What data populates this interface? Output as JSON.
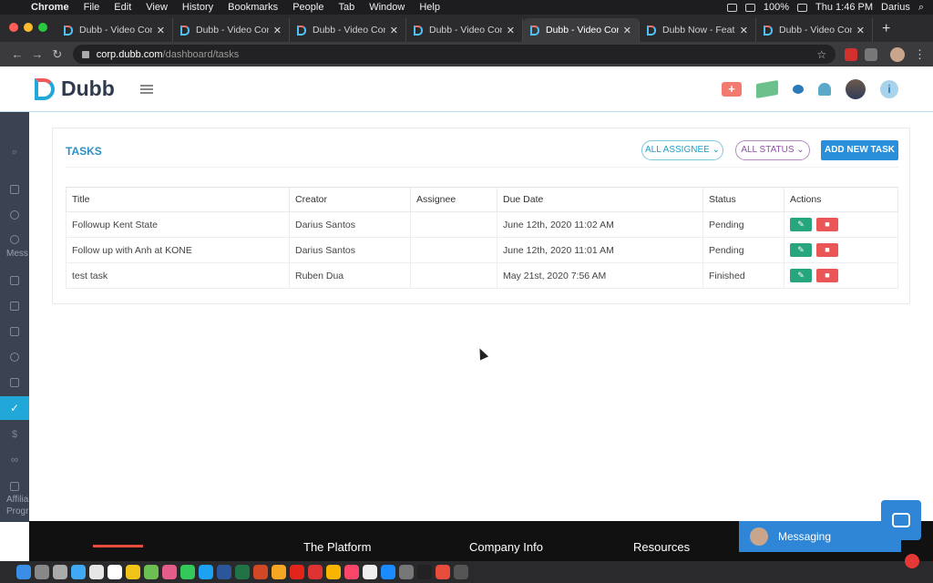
{
  "menubar": {
    "app_name": "Chrome",
    "menus": [
      "File",
      "Edit",
      "View",
      "History",
      "Bookmarks",
      "People",
      "Tab",
      "Window",
      "Help"
    ],
    "battery": "100%",
    "clock": "Thu 1:46 PM",
    "user": "Darius"
  },
  "tabs": [
    {
      "label": "Dubb - Video Comm",
      "active": false
    },
    {
      "label": "Dubb - Video Comm",
      "active": false
    },
    {
      "label": "Dubb - Video Comm",
      "active": false
    },
    {
      "label": "Dubb - Video Comm",
      "active": false
    },
    {
      "label": "Dubb - Video Comm",
      "active": true
    },
    {
      "label": "Dubb Now - Feature",
      "active": false
    },
    {
      "label": "Dubb - Video Comm",
      "active": false
    }
  ],
  "address": {
    "host": "corp.dubb.com",
    "path": "/dashboard/tasks"
  },
  "header": {
    "logo_text": "Dubb",
    "icons": [
      "video-plus-icon",
      "money-icon",
      "chat-icon",
      "bell-icon",
      "user-avatar",
      "info-icon"
    ]
  },
  "sidebar": {
    "labels": {
      "messages": "Mess",
      "affiliate_line1": "Affilia",
      "affiliate_line2": "Progr"
    }
  },
  "tasks": {
    "title": "TASKS",
    "assignee_filter": "ALL ASSIGNEE",
    "status_filter": "ALL STATUS",
    "add_button": "ADD NEW TASK",
    "columns": [
      "Title",
      "Creator",
      "Assignee",
      "Due Date",
      "Status",
      "Actions"
    ],
    "rows": [
      {
        "title": "Followup Kent State",
        "creator": "Darius Santos",
        "assignee": "",
        "due": "June 12th, 2020 11:02 AM",
        "status": "Pending"
      },
      {
        "title": "Follow up with Anh at KONE",
        "creator": "Darius Santos",
        "assignee": "",
        "due": "June 12th, 2020 11:01 AM",
        "status": "Pending"
      },
      {
        "title": "test task",
        "creator": "Ruben Dua",
        "assignee": "",
        "due": "May 21st, 2020 7:56 AM",
        "status": "Finished"
      }
    ]
  },
  "footer": {
    "col1": "The Platform",
    "col2": "Company Info",
    "col3": "Resources"
  },
  "messaging": {
    "label": "Messaging"
  },
  "colors": {
    "accent_blue": "#21a8d8",
    "primary_button": "#2a8fdb",
    "edit_green": "#26a57e",
    "delete_red": "#ea5656",
    "sidebar_bg": "#3b4251"
  }
}
